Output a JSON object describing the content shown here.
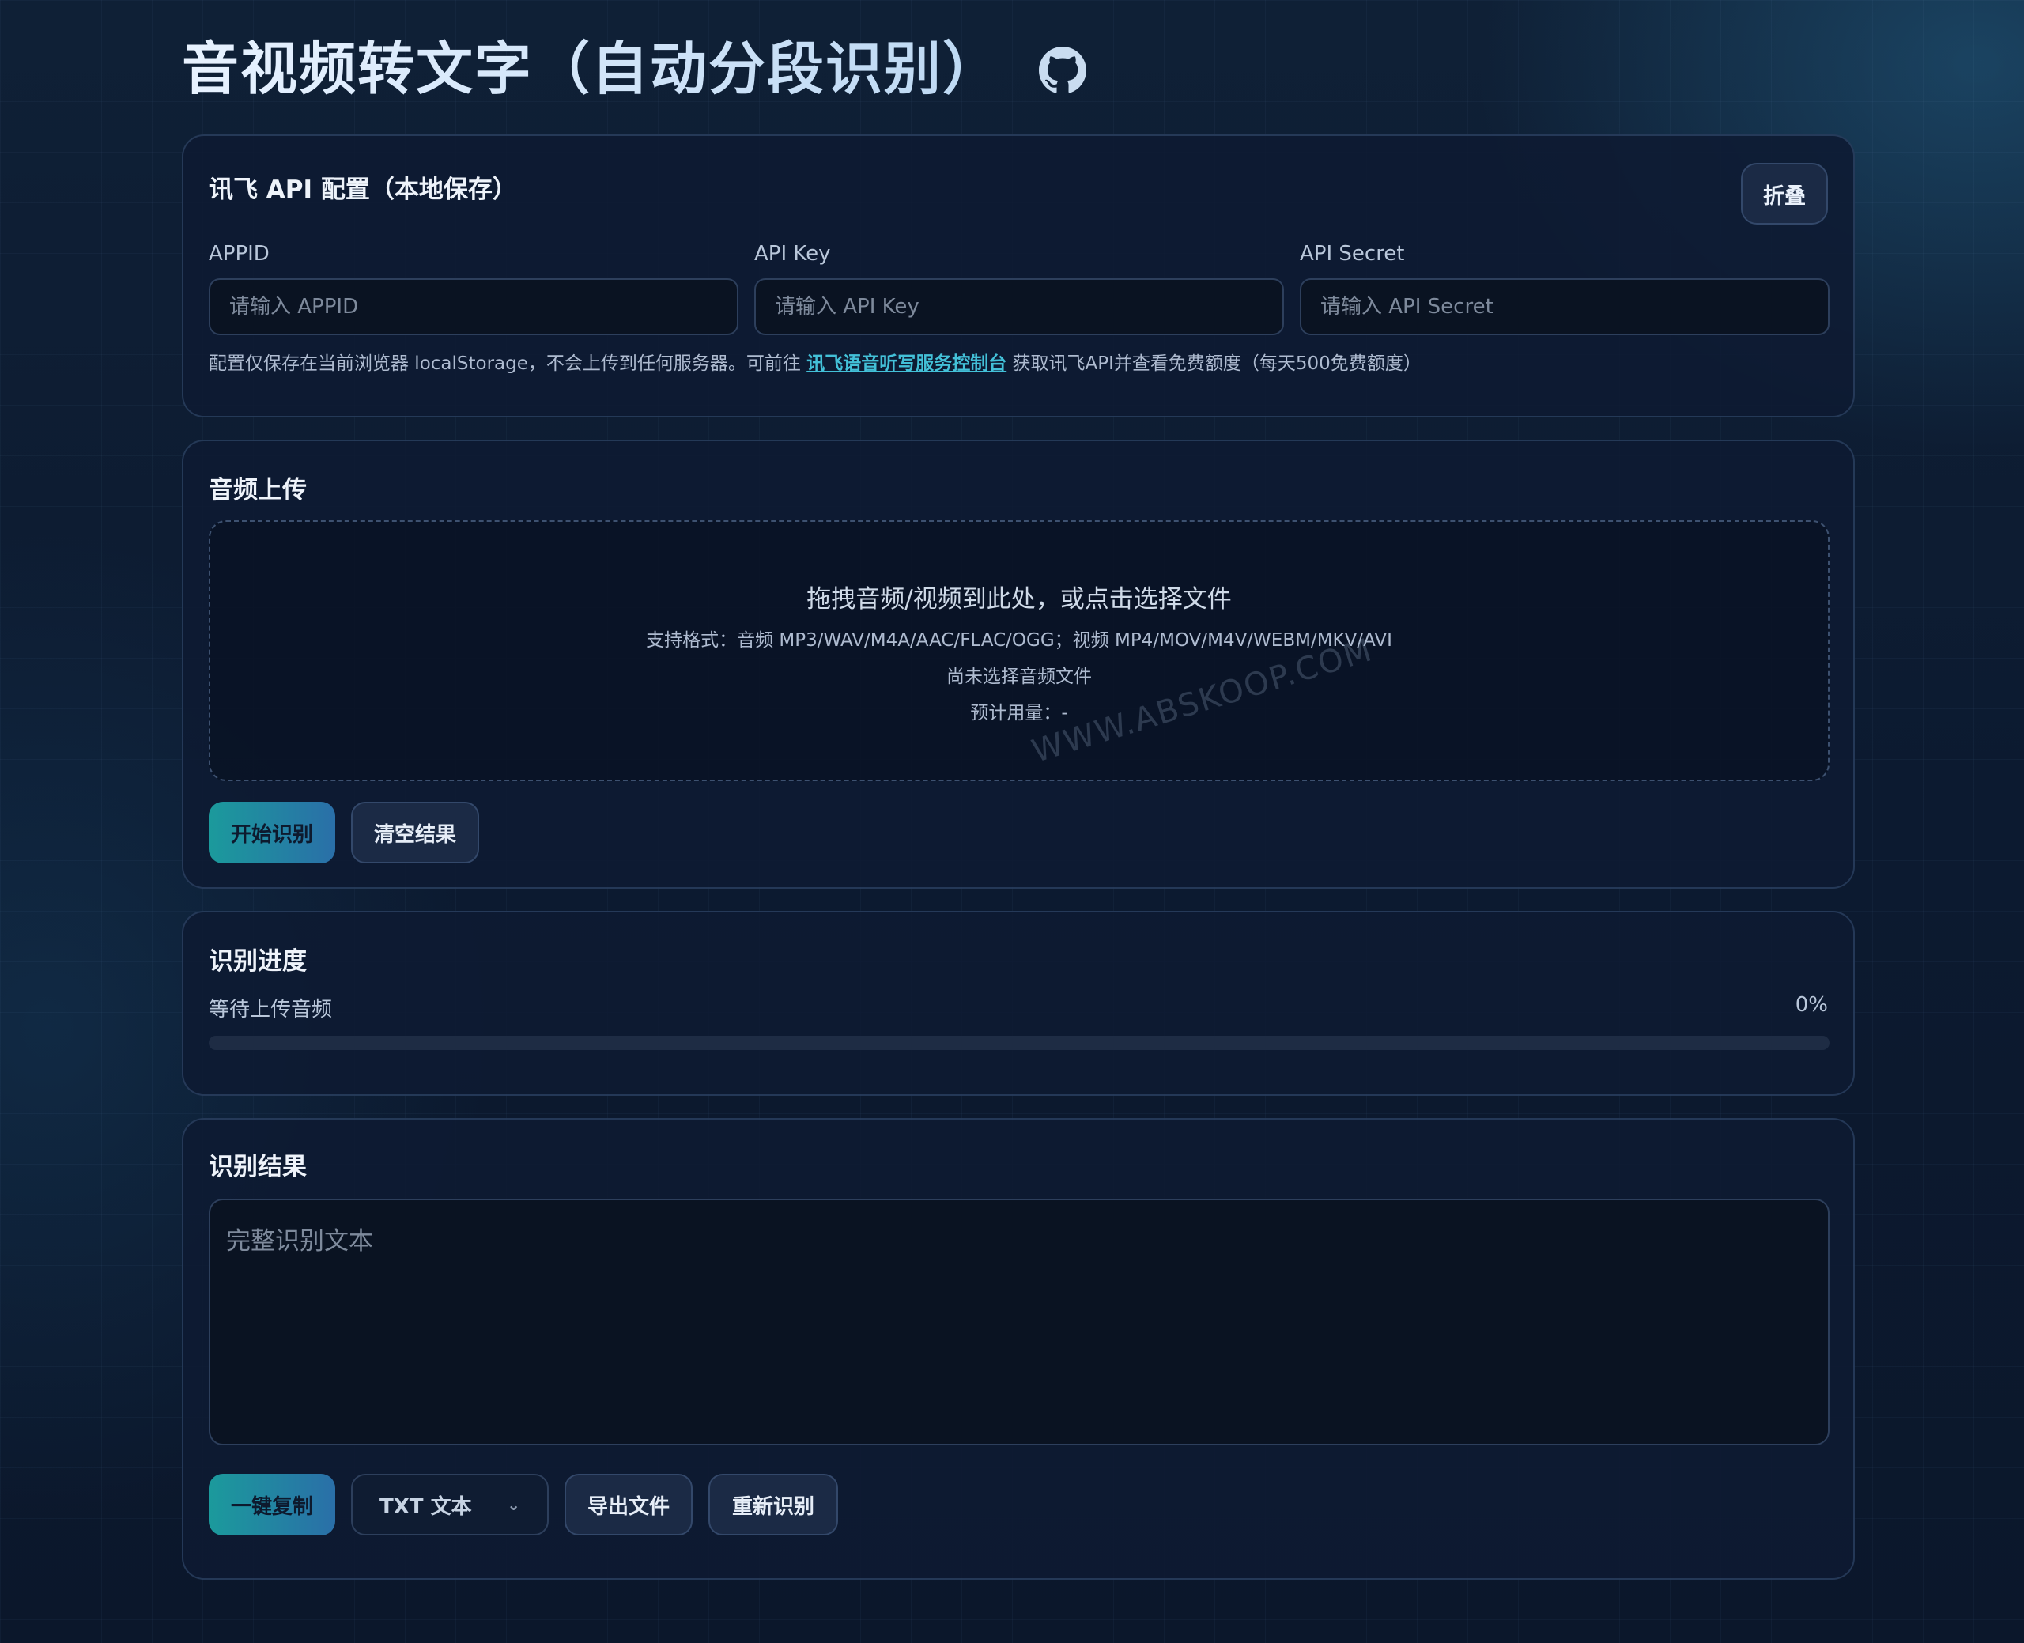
{
  "header": {
    "title": "音视频转文字（自动分段识别）",
    "github_icon": "github-icon"
  },
  "api_config": {
    "title": "讯飞 API 配置（本地保存）",
    "collapse_label": "折叠",
    "appid": {
      "label": "APPID",
      "placeholder": "请输入 APPID",
      "value": ""
    },
    "api_key": {
      "label": "API Key",
      "placeholder": "请输入 API Key",
      "value": ""
    },
    "api_secret": {
      "label": "API Secret",
      "placeholder": "请输入 API Secret",
      "value": ""
    },
    "note_prefix": "配置仅保存在当前浏览器 localStorage，不会上传到任何服务器。可前往",
    "note_link": "讯飞语音听写服务控制台",
    "note_suffix": "获取讯飞API并查看免费额度（每天500免费额度）"
  },
  "upload": {
    "title": "音频上传",
    "drop_main": "拖拽音频/视频到此处，或点击选择文件",
    "formats": "支持格式：音频 MP3/WAV/M4A/AAC/FLAC/OGG；视频 MP4/MOV/M4V/WEBM/MKV/AVI",
    "file_status": "尚未选择音频文件",
    "usage_estimate": "预计用量：-",
    "start_label": "开始识别",
    "clear_label": "清空结果"
  },
  "watermark": "WWW.ABSKOOP.COM",
  "progress": {
    "title": "识别进度",
    "status": "等待上传音频",
    "percent_label": "0%",
    "percent": 0
  },
  "result": {
    "title": "识别结果",
    "placeholder": "完整识别文本",
    "value": "",
    "copy_label": "一键复制",
    "format_selected": "TXT 文本",
    "export_label": "导出文件",
    "redo_label": "重新识别"
  },
  "colors": {
    "accent_start": "#1b9a9c",
    "accent_end": "#2a6fa8",
    "link": "#43c0d8",
    "background": "#0c1a30"
  }
}
